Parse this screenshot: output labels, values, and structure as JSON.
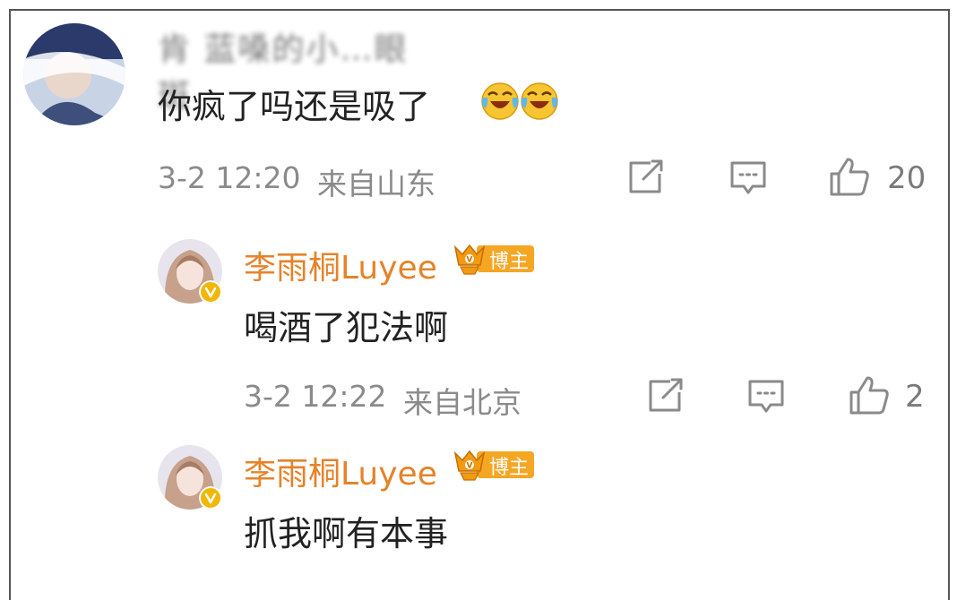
{
  "comment": {
    "username": "肯 蓝嗓的小…眼斑",
    "text": "你疯了吗还是吸了",
    "emoji": [
      "laugh-cry",
      "laugh-cry"
    ],
    "timestamp": "3-2 12:20",
    "location": "来自山东",
    "like_count": "20"
  },
  "replies": [
    {
      "author": "李雨桐Luyee",
      "badge": "博主",
      "text": "喝酒了犯法啊",
      "timestamp": "3-2 12:22",
      "location": "来自北京",
      "like_count": "2"
    },
    {
      "author": "李雨桐Luyee",
      "badge": "博主",
      "text": "抓我啊有本事"
    }
  ],
  "colors": {
    "author": "#e5832a",
    "badge_bg": "#f5a623",
    "verified": "#f2b705"
  }
}
